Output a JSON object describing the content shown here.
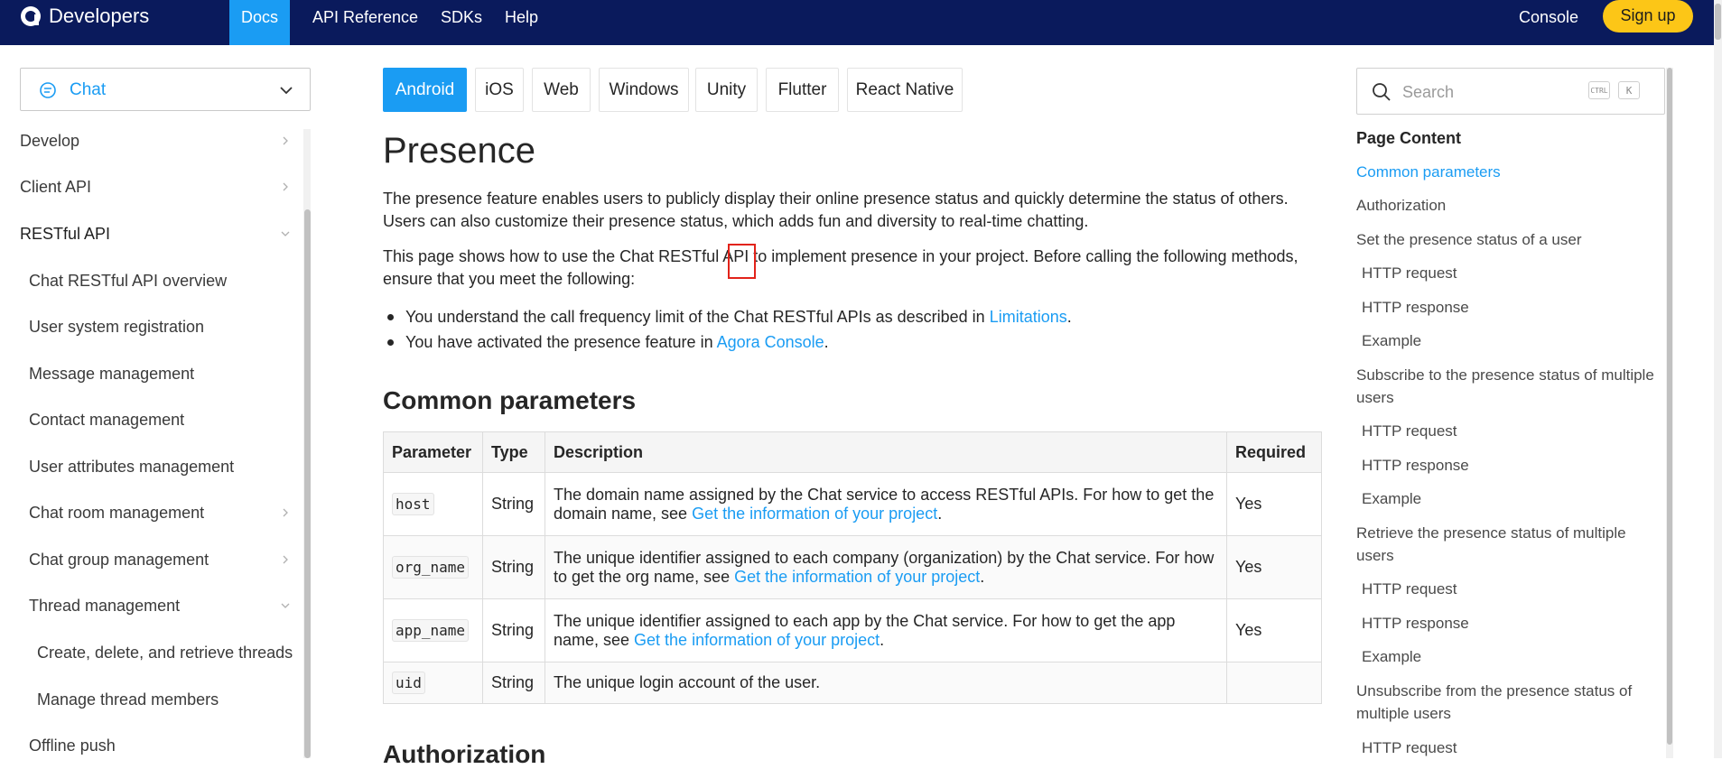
{
  "topbar": {
    "brand": "Developers",
    "nav": [
      "Docs",
      "API Reference",
      "SDKs",
      "Help"
    ],
    "console": "Console",
    "signup": "Sign up"
  },
  "sidebar": {
    "product": "Chat",
    "items": [
      {
        "label": "Develop"
      },
      {
        "label": "Client API"
      },
      {
        "label": "RESTful API"
      },
      {
        "label": "Chat RESTful API overview"
      },
      {
        "label": "User system registration"
      },
      {
        "label": "Message management"
      },
      {
        "label": "Contact management"
      },
      {
        "label": "User attributes management"
      },
      {
        "label": "Chat room management"
      },
      {
        "label": "Chat group management"
      },
      {
        "label": "Thread management"
      },
      {
        "label": "Create, delete, and retrieve threads"
      },
      {
        "label": "Manage thread members"
      },
      {
        "label": "Offline push"
      }
    ]
  },
  "tabs": [
    "Android",
    "iOS",
    "Web",
    "Windows",
    "Unity",
    "Flutter",
    "React Native"
  ],
  "content": {
    "title": "Presence",
    "para1": "The presence feature enables users to publicly display their online presence status and quickly determine the status of others. Users can also customize their presence status, which adds fun and diversity to real-time chatting.",
    "para2_a": "This page shows how to use the Chat RESTful ",
    "para2_api": "API",
    "para2_b": " to implement presence in your project. Before calling the following methods, ensure that you meet the following:",
    "bullet1_a": "You understand the call frequency limit of the Chat RESTful APIs as described in ",
    "bullet1_link": "Limitations",
    "bullet1_b": ".",
    "bullet2_a": "You have activated the presence feature in ",
    "bullet2_link": "Agora Console",
    "bullet2_b": ".",
    "h2_common": "Common parameters",
    "h2_auth": "Authorization"
  },
  "table": {
    "headers": [
      "Parameter",
      "Type",
      "Description",
      "Required"
    ],
    "rows": [
      {
        "param": "host",
        "type": "String",
        "desc": "The domain name assigned by the Chat service to access RESTful APIs. For how to get the domain name, see ",
        "link": "Get the information of your project",
        "end": ".",
        "required": "Yes"
      },
      {
        "param": "org_name",
        "type": "String",
        "desc": "The unique identifier assigned to each company (organization) by the Chat service. For how to get the org name, see ",
        "link": "Get the information of your project",
        "end": ".",
        "required": "Yes"
      },
      {
        "param": "app_name",
        "type": "String",
        "desc": "The unique identifier assigned to each app by the Chat service. For how to get the app name, see ",
        "link": "Get the information of your project",
        "end": ".",
        "required": "Yes"
      },
      {
        "param": "uid",
        "type": "String",
        "desc": "The unique login account of the user.",
        "link": "",
        "end": "",
        "required": ""
      }
    ]
  },
  "search": {
    "placeholder": "Search",
    "kbd_ctrl": "CTRL",
    "kbd_k": "K"
  },
  "toc": {
    "title": "Page Content",
    "items": [
      "Common parameters",
      "Authorization",
      "Set the presence status of a user",
      "HTTP request",
      "HTTP response",
      "Example",
      "Subscribe to the presence status of multiple users",
      "HTTP request",
      "HTTP response",
      "Example",
      "Retrieve the presence status of multiple users",
      "HTTP request",
      "HTTP response",
      "Example",
      "Unsubscribe from the presence status of multiple users",
      "HTTP request"
    ]
  },
  "colors": {
    "topbar": "#0a1a5c",
    "accent": "#1a9cf3",
    "signup": "#fcc617",
    "highlight": "#e2231a"
  }
}
